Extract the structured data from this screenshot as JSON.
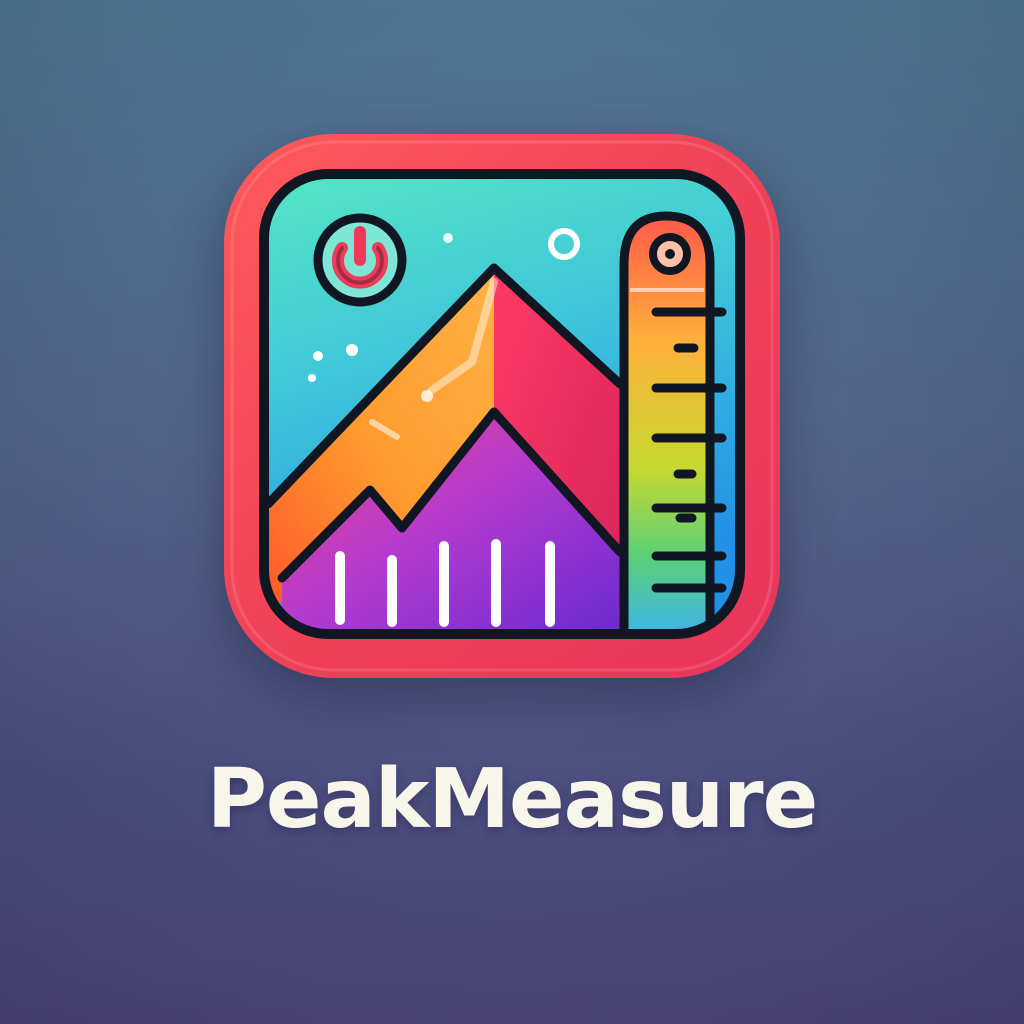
{
  "brand": {
    "name": "PeakMeasure"
  },
  "colors": {
    "background_top": "#4f7591",
    "background_bottom": "#4b4477",
    "frame": "#f04258",
    "sky_top": "#4fe0c8",
    "sky_bottom": "#2aa8e0",
    "mountain_red": "#f2365a",
    "mountain_orange": "#ff8c2a",
    "mountain_purple": "#7a2fd0",
    "outline": "#111722",
    "wordmark": "#f8f6ea"
  },
  "icons": {
    "app_icon": "mountain-ruler-icon",
    "power": "power-icon",
    "ruler": "ruler-icon",
    "mountain": "mountain-icon"
  }
}
